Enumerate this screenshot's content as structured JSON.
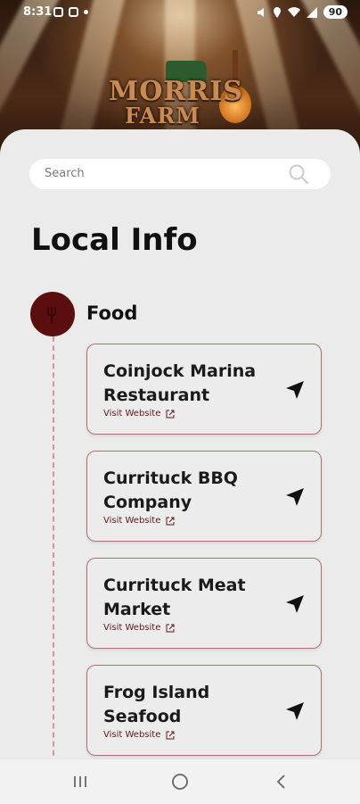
{
  "status": {
    "time": "8:31",
    "battery": "90"
  },
  "brand": {
    "line1": "MORRIS",
    "line2": "FARM"
  },
  "search": {
    "placeholder": "Search"
  },
  "page": {
    "title": "Local Info"
  },
  "category": {
    "label": "Food",
    "icon": "utensils-icon"
  },
  "items": [
    {
      "name": "Coinjock Marina Restaurant",
      "link": "Visit Website"
    },
    {
      "name": "Currituck BBQ Company",
      "link": "Visit Website"
    },
    {
      "name": "Currituck Meat Market",
      "link": "Visit Website"
    },
    {
      "name": "Frog Island Seafood",
      "link": "Visit Website"
    }
  ],
  "colors": {
    "accent": "#5a0e0e",
    "card_border": "#a97373",
    "sheet": "#ebebeb"
  }
}
